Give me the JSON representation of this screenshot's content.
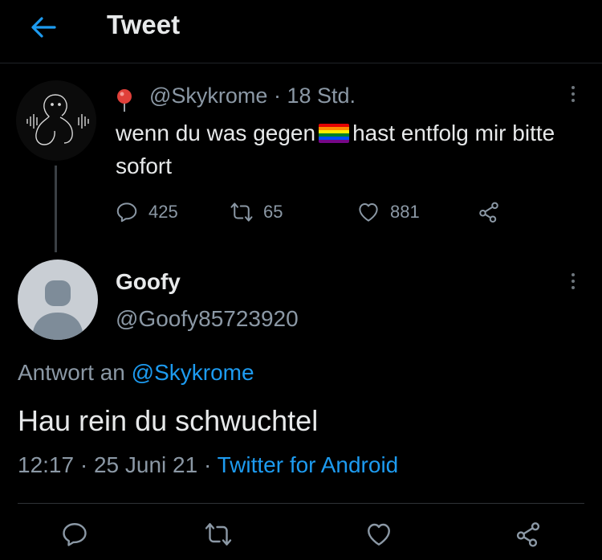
{
  "header": {
    "title": "Tweet",
    "back_icon": "arrow-left-icon"
  },
  "tweet1": {
    "handle": "@Skykrome",
    "separator": " · ",
    "age": "18 Std.",
    "text_before_flag": "wenn du was gegen",
    "flag_icon": "rainbow-flag-icon",
    "text_after_flag": "hast entfolg mir bitte sofort",
    "reply_count": "425",
    "retweet_count": "65",
    "like_count": "881"
  },
  "tweet2": {
    "name": "Goofy",
    "handle": "@Goofy85723920",
    "reply_to_prefix": "Antwort an ",
    "reply_to_handle": "@Skykrome",
    "text": "Hau rein du schwuchtel",
    "time": "12:17",
    "date": "25 Juni 21",
    "separator": " · ",
    "client": "Twitter for Android"
  },
  "colors": {
    "background": "#000000",
    "link": "#1d9bf0",
    "muted": "#8b98a5",
    "text": "#e7e9ea"
  }
}
